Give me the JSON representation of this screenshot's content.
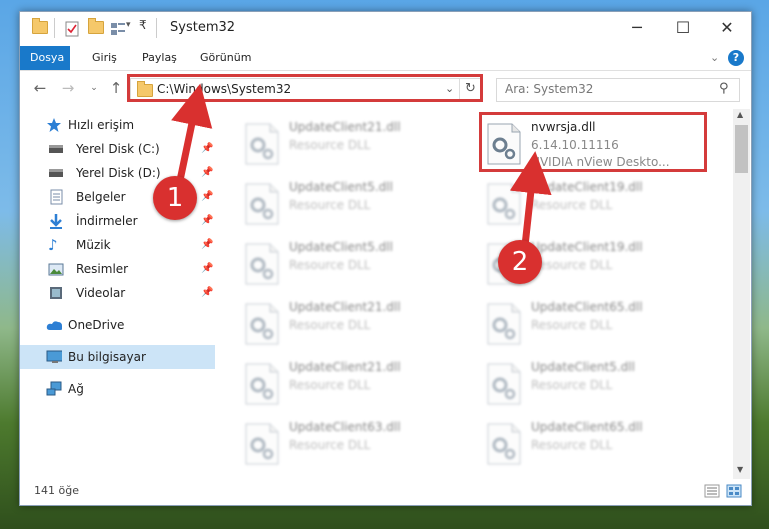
{
  "window": {
    "title": "System32"
  },
  "ribbon": {
    "tabs": [
      "Dosya",
      "Giriş",
      "Paylaş",
      "Görünüm"
    ],
    "active_tab": "Dosya"
  },
  "address": {
    "path": "C:\\Windows\\System32"
  },
  "search": {
    "placeholder": "Ara: System32"
  },
  "sidebar": {
    "items": [
      {
        "label": "Hızlı erişim",
        "icon": "star-icon",
        "pinned": false
      },
      {
        "label": "Yerel Disk (C:)",
        "icon": "drive-icon",
        "pinned": true
      },
      {
        "label": "Yerel Disk (D:)",
        "icon": "drive-icon",
        "pinned": true
      },
      {
        "label": "Belgeler",
        "icon": "documents-icon",
        "pinned": true
      },
      {
        "label": "İndirmeler",
        "icon": "downloads-icon",
        "pinned": true
      },
      {
        "label": "Müzik",
        "icon": "music-icon",
        "pinned": true
      },
      {
        "label": "Resimler",
        "icon": "pictures-icon",
        "pinned": true
      },
      {
        "label": "Videolar",
        "icon": "videos-icon",
        "pinned": true
      },
      {
        "label": "OneDrive",
        "icon": "cloud-icon",
        "pinned": false
      },
      {
        "label": "Bu bilgisayar",
        "icon": "computer-icon",
        "pinned": false,
        "selected": true
      },
      {
        "label": "Ağ",
        "icon": "network-icon",
        "pinned": false
      }
    ]
  },
  "files": [
    {
      "name": "UpdateClient21.dll",
      "desc": "Resource DLL"
    },
    {
      "name": "nvwrsja.dll",
      "desc": "6.14.10.11116",
      "desc2": "NVIDIA nView Deskto...",
      "highlighted": true
    },
    {
      "name": "UpdateClient5.dll",
      "desc": "Resource DLL"
    },
    {
      "name": "UpdateClient19.dll",
      "desc": "Resource DLL"
    },
    {
      "name": "UpdateClient5.dll",
      "desc": "Resource DLL"
    },
    {
      "name": "UpdateClient19.dll",
      "desc": "Resource DLL"
    },
    {
      "name": "UpdateClient21.dll",
      "desc": "Resource DLL"
    },
    {
      "name": "UpdateClient65.dll",
      "desc": "Resource DLL"
    },
    {
      "name": "UpdateClient21.dll",
      "desc": "Resource DLL"
    },
    {
      "name": "UpdateClient5.dll",
      "desc": "Resource DLL"
    },
    {
      "name": "UpdateClient63.dll",
      "desc": "Resource DLL"
    },
    {
      "name": "UpdateClient65.dll",
      "desc": "Resource DLL"
    }
  ],
  "status": {
    "count": "141 öğe"
  },
  "annotations": {
    "step1": "1",
    "step2": "2"
  },
  "colors": {
    "accent": "#1979ca",
    "highlight": "#d43b3b",
    "selected": "#cce4f7"
  }
}
